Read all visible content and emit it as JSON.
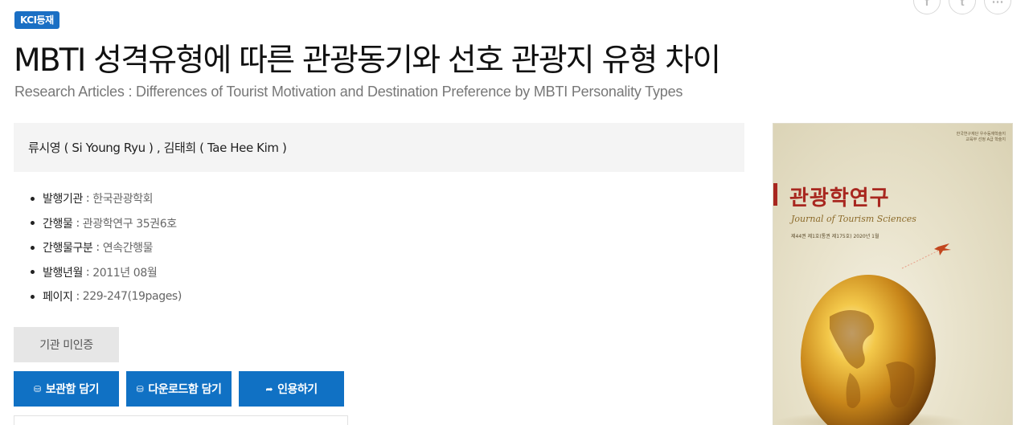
{
  "badge": "KCI등재",
  "title": "MBTI 성격유형에 따른 관광동기와 선호 관광지 유형 차이",
  "subtitle": "Research Articles : Differences of Tourist Motivation and Destination Preference by MBTI Personality Types",
  "authors": "류시영 ( Si Young Ryu ) , 김태희 ( Tae Hee Kim )",
  "meta": [
    {
      "key": "발행기관",
      "value": "한국관광학회"
    },
    {
      "key": "간행물",
      "value": "관광학연구 35권6호"
    },
    {
      "key": "간행물구분",
      "value": "연속간행물"
    },
    {
      "key": "발행년월",
      "value": "2011년 08월"
    },
    {
      "key": "페이지",
      "value": "229-247(19pages)"
    }
  ],
  "separator": ":",
  "institution_button": "기관 미인증",
  "actions": {
    "save": "보관함 담기",
    "download": "다운로드함 담기",
    "cite": "인용하기"
  },
  "share_icons": [
    "facebook-icon",
    "twitter-icon",
    "more-icon"
  ],
  "cover": {
    "publisher_line1": "한국연구재단 우수등재학술지",
    "publisher_line2": "교육부 선정 A급 학술지",
    "journal_title": "관광학연구",
    "journal_title_en": "Journal of Tourism Sciences",
    "issue": "제44권 제1호(통권 제175호) 2020년 1월"
  },
  "colors": {
    "accent": "#1071c4",
    "badge": "#1a6fc4",
    "cover_title": "#a8271f"
  }
}
